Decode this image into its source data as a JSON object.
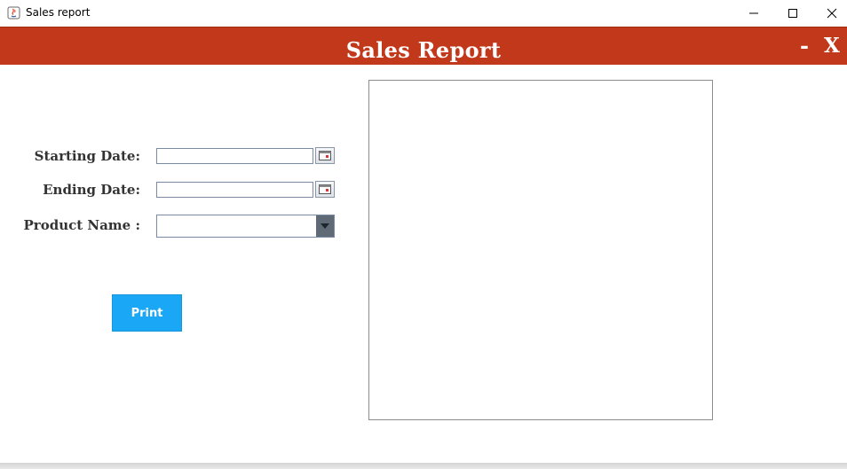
{
  "window": {
    "title": "Sales report",
    "controls": {
      "minimize": "minimize-icon",
      "maximize": "maximize-icon",
      "close": "close-icon"
    }
  },
  "header": {
    "title": "Sales Report",
    "minimize_label": "-",
    "close_label": "X",
    "background": "#c2381a"
  },
  "form": {
    "start_date": {
      "label": "Starting Date:",
      "value": ""
    },
    "end_date": {
      "label": "Ending Date:",
      "value": ""
    },
    "product": {
      "label": "Product Name :",
      "selected": ""
    },
    "print_label": "Print",
    "print_color": "#1aa7f5"
  }
}
